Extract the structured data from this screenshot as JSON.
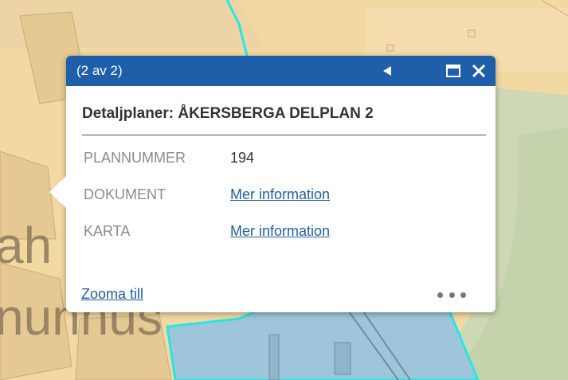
{
  "map": {
    "label_fragment_1": "ah",
    "label_fragment_2": "nunnus",
    "colors": {
      "background": "#f2d9a2",
      "building": "#e4c28c",
      "road": "#dfc79c",
      "plan_area_blue": "#9fc5da",
      "green_area": "#cfd8b4",
      "outline_cyan": "#29e5e5"
    }
  },
  "popup": {
    "counter": "(2 av 2)",
    "icons": {
      "previous": "triangle-left-icon",
      "maximize": "maximize-icon",
      "close": "close-icon",
      "more": "more-dots-icon"
    },
    "title": "Detaljplaner: ÅKERSBERGA DELPLAN 2",
    "attributes": [
      {
        "name": "PLANNUMMER",
        "value": "194",
        "link": false
      },
      {
        "name": "DOKUMENT",
        "value": "Mer information",
        "link": true
      },
      {
        "name": "KARTA",
        "value": "Mer information",
        "link": true
      }
    ],
    "zoom_label": "Zooma till",
    "header_color": "#1f5ea8",
    "link_color": "#1f5e9e"
  }
}
